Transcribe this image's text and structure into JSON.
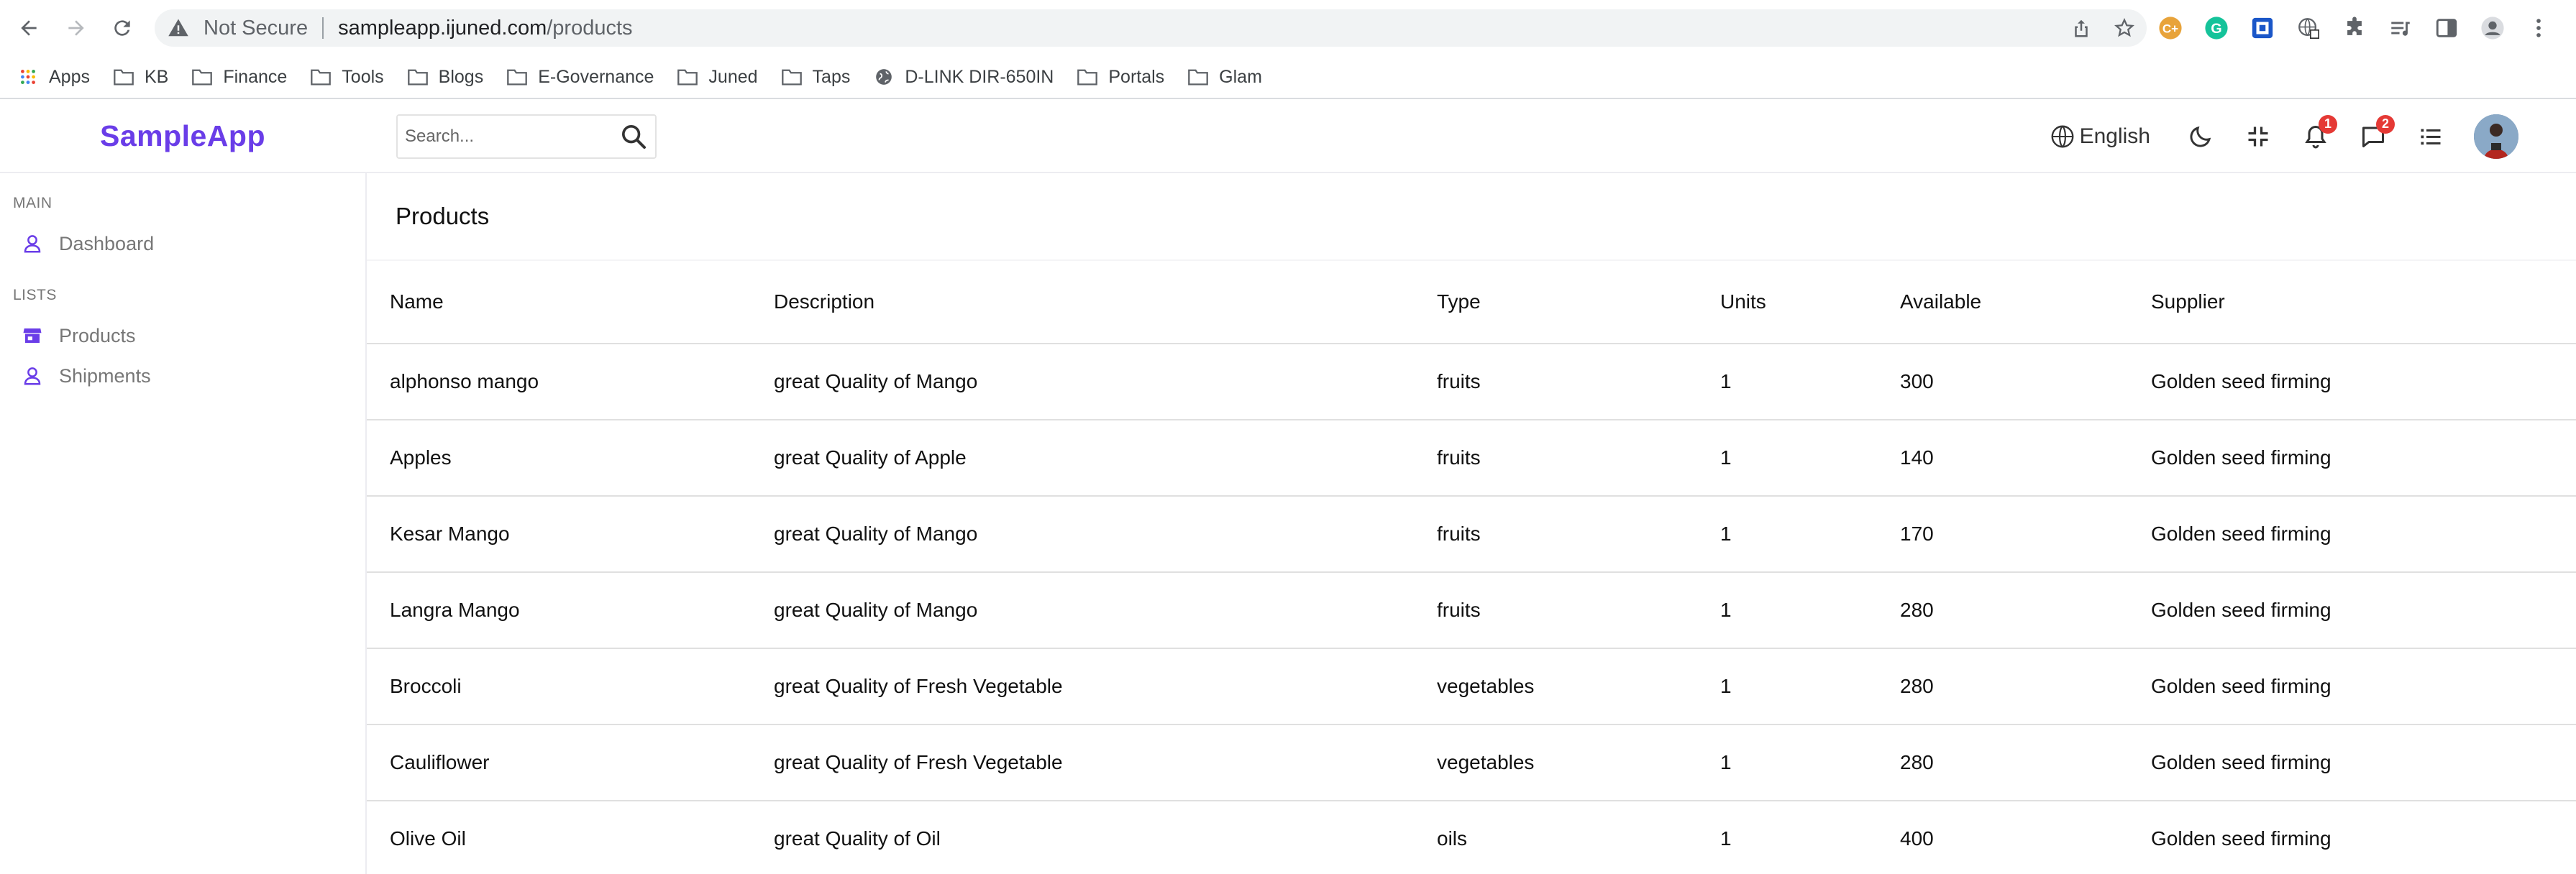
{
  "browser": {
    "not_secure_label": "Not Secure",
    "url_host": "sampleapp.ijuned.com",
    "url_path": "/products",
    "bookmarks": [
      {
        "label": "Apps",
        "icon": "apps-grid-icon"
      },
      {
        "label": "KB",
        "icon": "folder-icon"
      },
      {
        "label": "Finance",
        "icon": "folder-icon"
      },
      {
        "label": "Tools",
        "icon": "folder-icon"
      },
      {
        "label": "Blogs",
        "icon": "folder-icon"
      },
      {
        "label": "E-Governance",
        "icon": "folder-icon"
      },
      {
        "label": "Juned",
        "icon": "folder-icon"
      },
      {
        "label": "Taps",
        "icon": "folder-icon"
      },
      {
        "label": "D-LINK DIR-650IN",
        "icon": "globe-icon"
      },
      {
        "label": "Portals",
        "icon": "folder-icon"
      },
      {
        "label": "Glam",
        "icon": "folder-icon"
      }
    ]
  },
  "app": {
    "brand": "SampleApp",
    "brand_color": "#6a3de8",
    "search": {
      "placeholder": "Search..."
    },
    "language": "English",
    "notifications_count": "1",
    "messages_count": "2"
  },
  "sidebar": {
    "sections": [
      {
        "title": "MAIN",
        "items": [
          {
            "label": "Dashboard",
            "icon": "user-icon"
          }
        ]
      },
      {
        "title": "LISTS",
        "items": [
          {
            "label": "Products",
            "icon": "store-icon"
          },
          {
            "label": "Shipments",
            "icon": "user-icon"
          }
        ]
      }
    ]
  },
  "main": {
    "title": "Products",
    "table": {
      "columns": [
        "Name",
        "Description",
        "Type",
        "Units",
        "Available",
        "Supplier"
      ],
      "rows": [
        [
          "alphonso mango",
          "great Quality of Mango",
          "fruits",
          "1",
          "300",
          "Golden seed firming"
        ],
        [
          "Apples",
          "great Quality of Apple",
          "fruits",
          "1",
          "140",
          "Golden seed firming"
        ],
        [
          "Kesar Mango",
          "great Quality of Mango",
          "fruits",
          "1",
          "170",
          "Golden seed firming"
        ],
        [
          "Langra Mango",
          "great Quality of Mango",
          "fruits",
          "1",
          "280",
          "Golden seed firming"
        ],
        [
          "Broccoli",
          "great Quality of Fresh Vegetable",
          "vegetables",
          "1",
          "280",
          "Golden seed firming"
        ],
        [
          "Cauliflower",
          "great Quality of Fresh Vegetable",
          "vegetables",
          "1",
          "280",
          "Golden seed firming"
        ],
        [
          "Olive Oil",
          "great Quality of Oil",
          "oils",
          "1",
          "400",
          "Golden seed firming"
        ]
      ]
    }
  }
}
